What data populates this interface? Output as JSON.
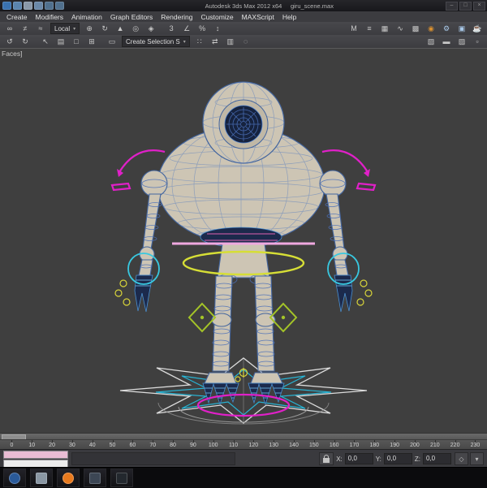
{
  "window": {
    "title": "Autodesk 3ds Max 2012 x64",
    "document": "giru_scene.max",
    "minimize": "–",
    "maximize": "□",
    "close": "×"
  },
  "quick_access": [
    {
      "name": "app-menu",
      "color": "#3a72b0"
    },
    {
      "name": "new-scene",
      "color": "#5a84ae"
    },
    {
      "name": "open-file",
      "color": "#8a98a8"
    },
    {
      "name": "save-file",
      "color": "#6a88a8"
    },
    {
      "name": "undo",
      "color": "#50708e"
    },
    {
      "name": "redo",
      "color": "#50708e"
    }
  ],
  "menu": {
    "items": [
      "Create",
      "Modifiers",
      "Animation",
      "Graph Editors",
      "Rendering",
      "Customize",
      "MAXScript",
      "Help"
    ]
  },
  "toolbar": {
    "row1": [
      {
        "name": "select-and-link-icon",
        "glyph": "∞"
      },
      {
        "name": "unlink-selection-icon",
        "glyph": "≠"
      },
      {
        "name": "bind-to-space-warp-icon",
        "glyph": "≈"
      },
      {
        "type": "dropdown",
        "name": "reference-coordinate-system-dropdown",
        "label": "Local"
      },
      {
        "name": "select-and-move-icon",
        "glyph": "⊕"
      },
      {
        "name": "select-and-rotate-icon",
        "glyph": "↻"
      },
      {
        "name": "select-and-scale-icon",
        "glyph": "▲"
      },
      {
        "name": "use-pivot-point-icon",
        "glyph": "◎"
      },
      {
        "name": "select-and-manipulate-icon",
        "glyph": "◈"
      },
      {
        "type": "sep"
      },
      {
        "name": "snaps-toggle-icon",
        "glyph": "3"
      },
      {
        "name": "angle-snap-icon",
        "glyph": "∠"
      },
      {
        "name": "percent-snap-icon",
        "glyph": "%"
      },
      {
        "name": "spinner-snap-icon",
        "glyph": "↕"
      },
      {
        "type": "grow"
      },
      {
        "name": "mirror-icon",
        "glyph": "M"
      },
      {
        "name": "align-icon",
        "glyph": "≡"
      },
      {
        "name": "layer-manager-icon",
        "glyph": "▦"
      },
      {
        "name": "curve-editor-icon",
        "glyph": "∿"
      },
      {
        "name": "schematic-view-icon",
        "glyph": "▩"
      },
      {
        "name": "material-editor-icon",
        "glyph": "◉",
        "color": "#d89030"
      },
      {
        "name": "render-setup-icon",
        "glyph": "⚙",
        "color": "#a8c8e8"
      },
      {
        "name": "rendered-frame-icon",
        "glyph": "▣",
        "color": "#a8c8e8"
      },
      {
        "name": "render-production-icon",
        "glyph": "☕",
        "color": "#8ab4d8"
      }
    ],
    "row2": [
      {
        "name": "undo-icon",
        "glyph": "↺"
      },
      {
        "name": "redo-icon",
        "glyph": "↻"
      },
      {
        "type": "sep"
      },
      {
        "name": "select-object-icon",
        "glyph": "↖"
      },
      {
        "name": "select-by-name-icon",
        "glyph": "▤"
      },
      {
        "name": "rectangular-selection-icon",
        "glyph": "□"
      },
      {
        "name": "window-crossing-icon",
        "glyph": "⊞"
      },
      {
        "type": "sep"
      },
      {
        "name": "edit-named-selection-sets-icon",
        "glyph": "▭"
      },
      {
        "type": "dropdown",
        "name": "named-selection-sets-dropdown",
        "label": "Create Selection S"
      },
      {
        "name": "array-icon",
        "glyph": "∷"
      },
      {
        "name": "align-camera-icon",
        "glyph": "⇄"
      },
      {
        "name": "spacing-tool-icon",
        "glyph": "▥"
      },
      {
        "name": "isolate-selection-icon",
        "glyph": "◌"
      },
      {
        "type": "grow"
      },
      {
        "name": "manage-layers-icon",
        "glyph": "▧"
      },
      {
        "name": "graphite-ribbon-icon",
        "glyph": "▬"
      },
      {
        "name": "scene-explorer-icon",
        "glyph": "▨"
      },
      {
        "name": "property-editor-icon",
        "glyph": "▫"
      }
    ]
  },
  "viewport": {
    "label": "Faces]"
  },
  "timeline": {
    "ticks": [
      "0",
      "10",
      "20",
      "30",
      "40",
      "50",
      "60",
      "70",
      "80",
      "90",
      "100",
      "110",
      "120",
      "130",
      "140",
      "150",
      "160",
      "170",
      "180",
      "190",
      "200",
      "210",
      "220",
      "230"
    ]
  },
  "status": {
    "x_label": "X:",
    "x_value": "0,0",
    "y_label": "Y:",
    "y_value": "0,0",
    "z_label": "Z:",
    "z_value": "0,0",
    "buttons": [
      {
        "name": "absolute-offset-mode-toggle",
        "glyph": "◇"
      },
      {
        "name": "time-tag-button",
        "glyph": "▾"
      }
    ]
  },
  "taskbar": {
    "items": [
      {
        "name": "start-button",
        "color": "#2a5a9a",
        "shape": "circle"
      },
      {
        "name": "file-explorer-icon",
        "color": "#8a97a4",
        "shape": "square"
      },
      {
        "name": "firefox-icon",
        "color": "#e87a1e",
        "shape": "circle"
      },
      {
        "name": "app-window-icon",
        "color": "#3c4654",
        "shape": "square"
      },
      {
        "name": "media-app-icon",
        "color": "#23282e",
        "shape": "square"
      }
    ]
  },
  "colors": {
    "viewport_bg": "#3f3f3f",
    "robot_body": "#cdc5b4",
    "wireframe_blue": "#4a6fb8",
    "eye_core": "#16233f",
    "gizmo_magenta": "#e020c8",
    "waist_pink": "#f0a8e0",
    "hip_yellow": "#d6de36",
    "knee_green": "#a4c428",
    "wrist_cyan": "#38c8e0",
    "platform_white": "#dcdcdc",
    "platform_cyan": "#28b4d4"
  }
}
